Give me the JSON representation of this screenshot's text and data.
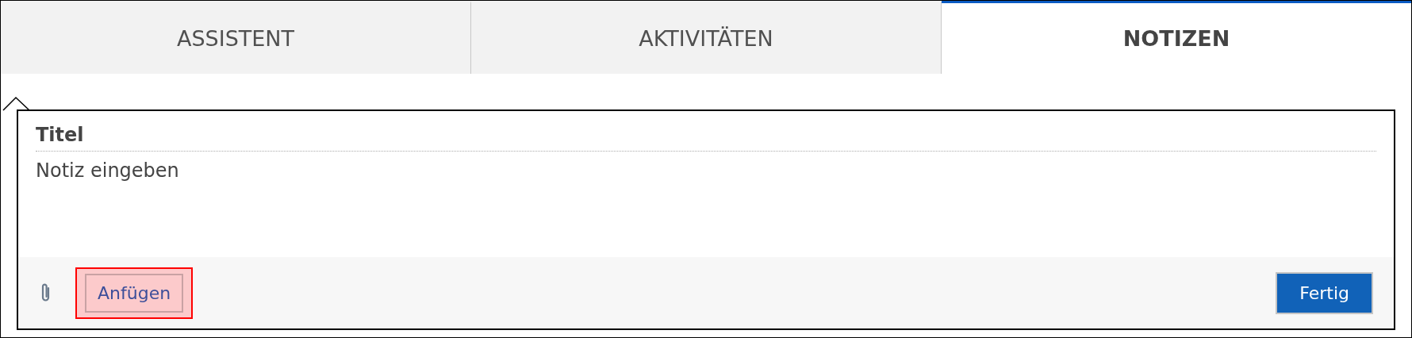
{
  "tabs": [
    {
      "label": "ASSISTENT",
      "selected": false
    },
    {
      "label": "AKTIVITÄTEN",
      "selected": false
    },
    {
      "label": "NOTIZEN",
      "selected": true
    }
  ],
  "note": {
    "title_field": {
      "placeholder": "Titel"
    },
    "body_field": {
      "placeholder": "Notiz eingeben"
    },
    "attach_button": {
      "label": "Anfügen",
      "highlighted": true
    },
    "done_button": {
      "label": "Fertig"
    }
  }
}
